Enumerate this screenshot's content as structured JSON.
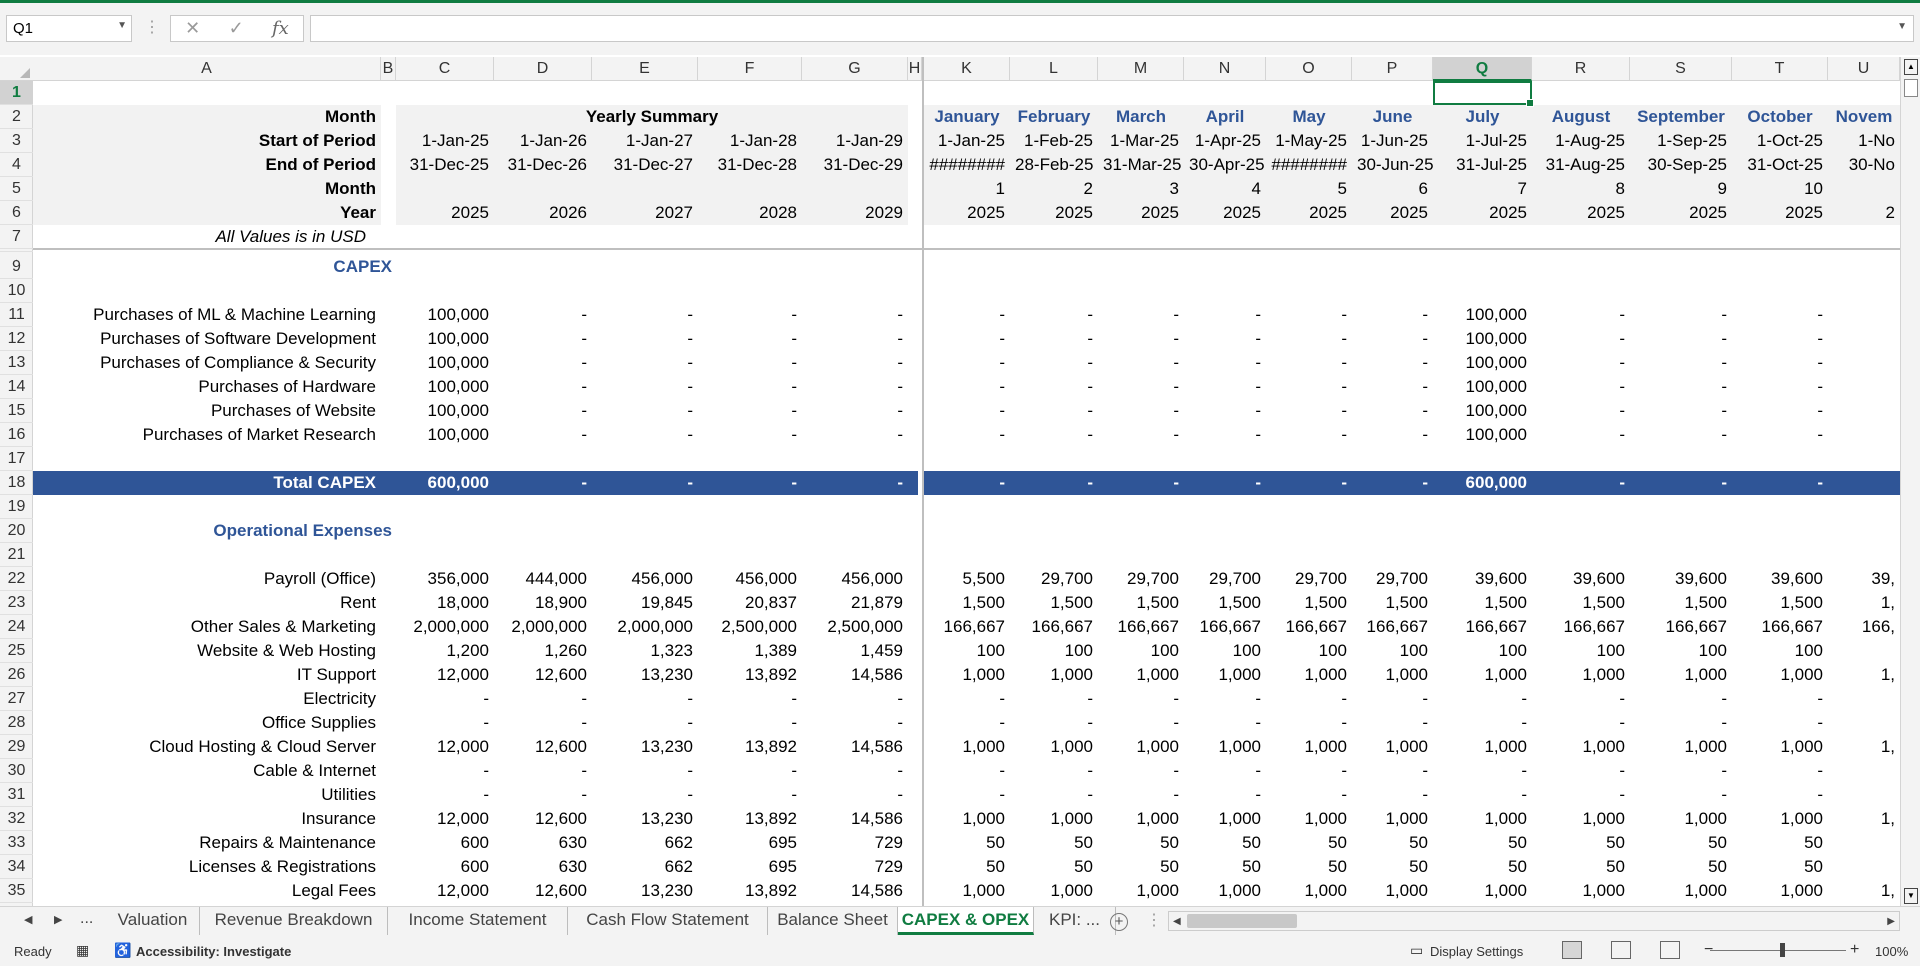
{
  "app": {
    "name_box": "Q1",
    "formula_value": ""
  },
  "columns": [
    "A",
    "B",
    "C",
    "D",
    "E",
    "F",
    "G",
    "H",
    "K",
    "L",
    "M",
    "N",
    "O",
    "P",
    "Q",
    "R",
    "S",
    "T",
    "U"
  ],
  "rows": [
    "1",
    "2",
    "3",
    "4",
    "5",
    "6",
    "7",
    "8",
    "9",
    "10",
    "11",
    "12",
    "13",
    "14",
    "15",
    "16",
    "17",
    "18",
    "19",
    "20",
    "21",
    "22",
    "23",
    "24",
    "25",
    "26",
    "27",
    "28",
    "29",
    "30",
    "31",
    "32",
    "33",
    "34",
    "35"
  ],
  "sheet": {
    "header_labels": {
      "month": "Month",
      "start": "Start of Period",
      "end": "End of Period",
      "month2": "Month",
      "year": "Year",
      "units_note": "All Values is in USD"
    },
    "yearly_summary_title": "Yearly Summary",
    "yearly_start": [
      "1-Jan-25",
      "1-Jan-26",
      "1-Jan-27",
      "1-Jan-28",
      "1-Jan-29"
    ],
    "yearly_end": [
      "31-Dec-25",
      "31-Dec-26",
      "31-Dec-27",
      "31-Dec-28",
      "31-Dec-29"
    ],
    "yearly_year": [
      "2025",
      "2026",
      "2027",
      "2028",
      "2029"
    ],
    "months": [
      "January",
      "February",
      "March",
      "April",
      "May",
      "June",
      "July",
      "August",
      "September",
      "October",
      "Novem"
    ],
    "month_start": [
      "1-Jan-25",
      "1-Feb-25",
      "1-Mar-25",
      "1-Apr-25",
      "1-May-25",
      "1-Jun-25",
      "1-Jul-25",
      "1-Aug-25",
      "1-Sep-25",
      "1-Oct-25",
      "1-No"
    ],
    "month_end": [
      "########",
      "28-Feb-25",
      "31-Mar-25",
      "30-Apr-25",
      "########",
      "30-Jun-25",
      "31-Jul-25",
      "31-Aug-25",
      "30-Sep-25",
      "31-Oct-25",
      "30-No"
    ],
    "month_num": [
      "1",
      "2",
      "3",
      "4",
      "5",
      "6",
      "7",
      "8",
      "9",
      "10",
      ""
    ],
    "month_year": [
      "2025",
      "2025",
      "2025",
      "2025",
      "2025",
      "2025",
      "2025",
      "2025",
      "2025",
      "2025",
      "2"
    ],
    "capex_title": "CAPEX",
    "capex_rows": [
      {
        "label": "Purchases of ML & Machine Learning",
        "yearly": [
          "100,000",
          "-",
          "-",
          "-",
          "-"
        ],
        "monthly": [
          "-",
          "-",
          "-",
          "-",
          "-",
          "-",
          "100,000",
          "-",
          "-",
          "-",
          ""
        ]
      },
      {
        "label": "Purchases of Software Development",
        "yearly": [
          "100,000",
          "-",
          "-",
          "-",
          "-"
        ],
        "monthly": [
          "-",
          "-",
          "-",
          "-",
          "-",
          "-",
          "100,000",
          "-",
          "-",
          "-",
          ""
        ]
      },
      {
        "label": "Purchases of Compliance & Security",
        "yearly": [
          "100,000",
          "-",
          "-",
          "-",
          "-"
        ],
        "monthly": [
          "-",
          "-",
          "-",
          "-",
          "-",
          "-",
          "100,000",
          "-",
          "-",
          "-",
          ""
        ]
      },
      {
        "label": "Purchases of Hardware",
        "yearly": [
          "100,000",
          "-",
          "-",
          "-",
          "-"
        ],
        "monthly": [
          "-",
          "-",
          "-",
          "-",
          "-",
          "-",
          "100,000",
          "-",
          "-",
          "-",
          ""
        ]
      },
      {
        "label": "Purchases of Website",
        "yearly": [
          "100,000",
          "-",
          "-",
          "-",
          "-"
        ],
        "monthly": [
          "-",
          "-",
          "-",
          "-",
          "-",
          "-",
          "100,000",
          "-",
          "-",
          "-",
          ""
        ]
      },
      {
        "label": "Purchases of Market Research",
        "yearly": [
          "100,000",
          "-",
          "-",
          "-",
          "-"
        ],
        "monthly": [
          "-",
          "-",
          "-",
          "-",
          "-",
          "-",
          "100,000",
          "-",
          "-",
          "-",
          ""
        ]
      }
    ],
    "total_capex": {
      "label": "Total CAPEX",
      "yearly": [
        "600,000",
        "-",
        "-",
        "-",
        "-"
      ],
      "monthly": [
        "-",
        "-",
        "-",
        "-",
        "-",
        "-",
        "600,000",
        "-",
        "-",
        "-",
        ""
      ]
    },
    "opex_title": "Operational Expenses",
    "opex_rows": [
      {
        "label": "Payroll (Office)",
        "yearly": [
          "356,000",
          "444,000",
          "456,000",
          "456,000",
          "456,000"
        ],
        "monthly": [
          "5,500",
          "29,700",
          "29,700",
          "29,700",
          "29,700",
          "29,700",
          "39,600",
          "39,600",
          "39,600",
          "39,600",
          "39,"
        ]
      },
      {
        "label": "Rent",
        "yearly": [
          "18,000",
          "18,900",
          "19,845",
          "20,837",
          "21,879"
        ],
        "monthly": [
          "1,500",
          "1,500",
          "1,500",
          "1,500",
          "1,500",
          "1,500",
          "1,500",
          "1,500",
          "1,500",
          "1,500",
          "1,"
        ]
      },
      {
        "label": "Other Sales & Marketing",
        "yearly": [
          "2,000,000",
          "2,000,000",
          "2,000,000",
          "2,500,000",
          "2,500,000"
        ],
        "monthly": [
          "166,667",
          "166,667",
          "166,667",
          "166,667",
          "166,667",
          "166,667",
          "166,667",
          "166,667",
          "166,667",
          "166,667",
          "166,"
        ]
      },
      {
        "label": "Website & Web Hosting",
        "yearly": [
          "1,200",
          "1,260",
          "1,323",
          "1,389",
          "1,459"
        ],
        "monthly": [
          "100",
          "100",
          "100",
          "100",
          "100",
          "100",
          "100",
          "100",
          "100",
          "100",
          ""
        ]
      },
      {
        "label": "IT Support",
        "yearly": [
          "12,000",
          "12,600",
          "13,230",
          "13,892",
          "14,586"
        ],
        "monthly": [
          "1,000",
          "1,000",
          "1,000",
          "1,000",
          "1,000",
          "1,000",
          "1,000",
          "1,000",
          "1,000",
          "1,000",
          "1,"
        ]
      },
      {
        "label": "Electricity",
        "yearly": [
          "-",
          "-",
          "-",
          "-",
          "-"
        ],
        "monthly": [
          "-",
          "-",
          "-",
          "-",
          "-",
          "-",
          "-",
          "-",
          "-",
          "-",
          ""
        ]
      },
      {
        "label": "Office Supplies",
        "yearly": [
          "-",
          "-",
          "-",
          "-",
          "-"
        ],
        "monthly": [
          "-",
          "-",
          "-",
          "-",
          "-",
          "-",
          "-",
          "-",
          "-",
          "-",
          ""
        ]
      },
      {
        "label": "Cloud Hosting & Cloud Server",
        "yearly": [
          "12,000",
          "12,600",
          "13,230",
          "13,892",
          "14,586"
        ],
        "monthly": [
          "1,000",
          "1,000",
          "1,000",
          "1,000",
          "1,000",
          "1,000",
          "1,000",
          "1,000",
          "1,000",
          "1,000",
          "1,"
        ]
      },
      {
        "label": "Cable & Internet",
        "yearly": [
          "-",
          "-",
          "-",
          "-",
          "-"
        ],
        "monthly": [
          "-",
          "-",
          "-",
          "-",
          "-",
          "-",
          "-",
          "-",
          "-",
          "-",
          ""
        ]
      },
      {
        "label": "Utilities",
        "yearly": [
          "-",
          "-",
          "-",
          "-",
          "-"
        ],
        "monthly": [
          "-",
          "-",
          "-",
          "-",
          "-",
          "-",
          "-",
          "-",
          "-",
          "-",
          ""
        ]
      },
      {
        "label": "Insurance",
        "yearly": [
          "12,000",
          "12,600",
          "13,230",
          "13,892",
          "14,586"
        ],
        "monthly": [
          "1,000",
          "1,000",
          "1,000",
          "1,000",
          "1,000",
          "1,000",
          "1,000",
          "1,000",
          "1,000",
          "1,000",
          "1,"
        ]
      },
      {
        "label": "Repairs & Maintenance",
        "yearly": [
          "600",
          "630",
          "662",
          "695",
          "729"
        ],
        "monthly": [
          "50",
          "50",
          "50",
          "50",
          "50",
          "50",
          "50",
          "50",
          "50",
          "50",
          ""
        ]
      },
      {
        "label": "Licenses & Registrations",
        "yearly": [
          "600",
          "630",
          "662",
          "695",
          "729"
        ],
        "monthly": [
          "50",
          "50",
          "50",
          "50",
          "50",
          "50",
          "50",
          "50",
          "50",
          "50",
          ""
        ]
      },
      {
        "label": "Legal Fees",
        "yearly": [
          "12,000",
          "12,600",
          "13,230",
          "13,892",
          "14,586"
        ],
        "monthly": [
          "1,000",
          "1,000",
          "1,000",
          "1,000",
          "1,000",
          "1,000",
          "1,000",
          "1,000",
          "1,000",
          "1,000",
          "1,"
        ]
      }
    ]
  },
  "tabs": {
    "nav_more": "...",
    "items": [
      "Valuation",
      "Revenue Breakdown",
      "Income Statement",
      "Cash Flow Statement",
      "Balance Sheet",
      "CAPEX & OPEX",
      "KPI: ..."
    ],
    "active": "CAPEX & OPEX"
  },
  "status": {
    "ready": "Ready",
    "accessibility": "Accessibility: Investigate",
    "display_settings": "Display Settings",
    "zoom": "100%",
    "zoom_minus": "−",
    "zoom_plus": "+"
  },
  "colors": {
    "accent": "#107c41",
    "band": "#2f5597",
    "section_title": "#2f5597"
  },
  "icons": [
    "dropdown-icon",
    "cancel-icon",
    "enter-icon",
    "function-icon",
    "scroll-up-icon",
    "scroll-down-icon",
    "add-sheet-icon",
    "accessibility-icon",
    "display-settings-icon",
    "normal-view-icon",
    "page-layout-icon",
    "page-break-icon"
  ]
}
